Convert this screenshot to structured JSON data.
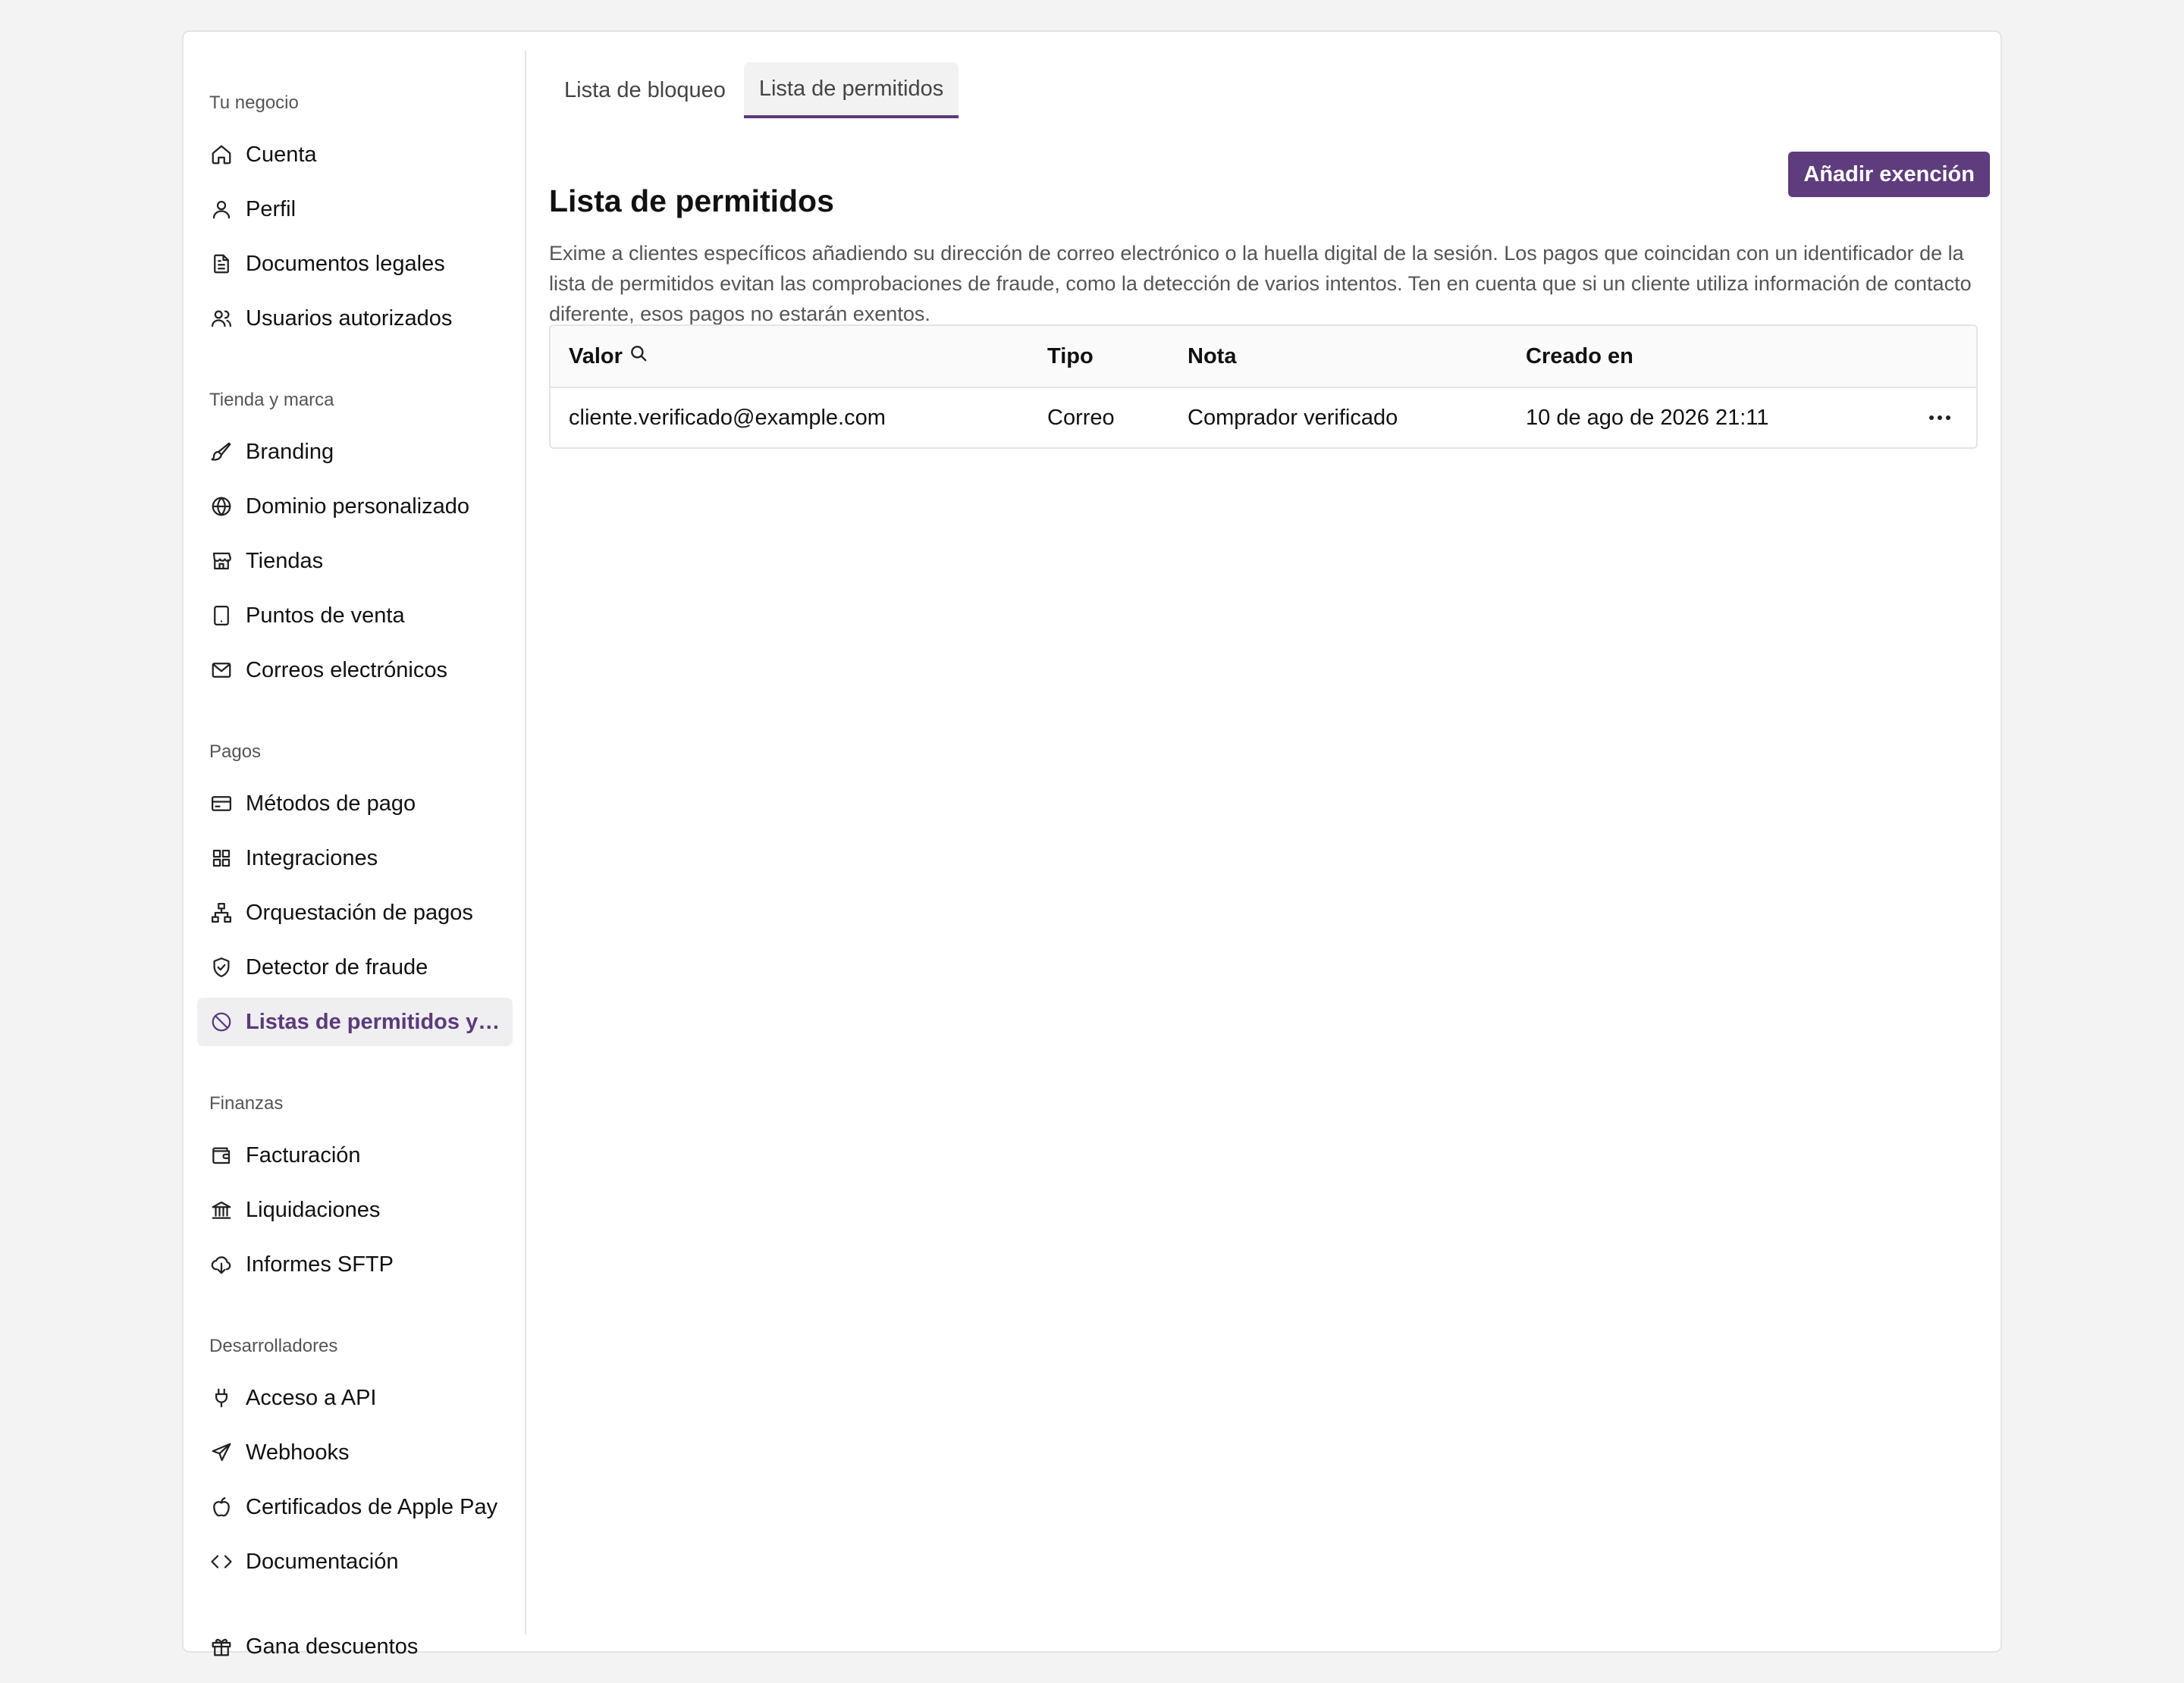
{
  "sidebar": {
    "sections": [
      {
        "label": "Tu negocio"
      },
      {
        "label": "Tienda y marca"
      },
      {
        "label": "Pagos"
      },
      {
        "label": "Finanzas"
      },
      {
        "label": "Desarrolladores"
      }
    ],
    "items": [
      {
        "label": "Cuenta",
        "icon": "home-icon"
      },
      {
        "label": "Perfil",
        "icon": "user-icon"
      },
      {
        "label": "Documentos legales",
        "icon": "document-icon"
      },
      {
        "label": "Usuarios autorizados",
        "icon": "users-icon"
      },
      {
        "label": "Branding",
        "icon": "brush-icon"
      },
      {
        "label": "Dominio personalizado",
        "icon": "globe-icon"
      },
      {
        "label": "Tiendas",
        "icon": "store-icon"
      },
      {
        "label": "Puntos de venta",
        "icon": "tablet-icon"
      },
      {
        "label": "Correos electrónicos",
        "icon": "mail-icon"
      },
      {
        "label": "Métodos de pago",
        "icon": "credit-card-icon"
      },
      {
        "label": "Integraciones",
        "icon": "grid-icon"
      },
      {
        "label": "Orquestación de pagos",
        "icon": "network-icon"
      },
      {
        "label": "Detector de fraude",
        "icon": "shield-icon"
      },
      {
        "label": "Listas de permitidos y d...",
        "icon": "ban-icon"
      },
      {
        "label": "Facturación",
        "icon": "wallet-icon"
      },
      {
        "label": "Liquidaciones",
        "icon": "bank-icon"
      },
      {
        "label": "Informes SFTP",
        "icon": "cloud-download-icon"
      },
      {
        "label": "Acceso a API",
        "icon": "plug-icon"
      },
      {
        "label": "Webhooks",
        "icon": "send-icon"
      },
      {
        "label": "Certificados de Apple Pay",
        "icon": "apple-icon"
      },
      {
        "label": "Documentación",
        "icon": "code-icon"
      },
      {
        "label": "Gana descuentos",
        "icon": "gift-icon"
      }
    ],
    "active_item": "Listas de permitidos y d..."
  },
  "tabs": [
    {
      "label": "Lista de bloqueo"
    },
    {
      "label": "Lista de permitidos"
    }
  ],
  "page": {
    "title": "Lista de permitidos",
    "add_button": "Añadir exención",
    "description": "Exime a clientes específicos añadiendo su dirección de correo electrónico o la huella digital de la sesión. Los pagos que coincidan con un identificador de la lista de permitidos evitan las comprobaciones de fraude, como la detección de varios intentos. Ten en cuenta que si un cliente utiliza información de contacto diferente, esos pagos no estarán exentos."
  },
  "table": {
    "headers": [
      "Valor",
      "Tipo",
      "Nota",
      "Creado en"
    ],
    "rows": [
      {
        "valor": "cliente.verificado@example.com",
        "tipo": "Correo",
        "nota": "Comprador verificado",
        "creado": "10 de ago de 2026 21:11"
      }
    ]
  },
  "colors": {
    "accent": "#5e3c7d",
    "active_bg": "#efeef1",
    "background": "#f3f3f3"
  }
}
